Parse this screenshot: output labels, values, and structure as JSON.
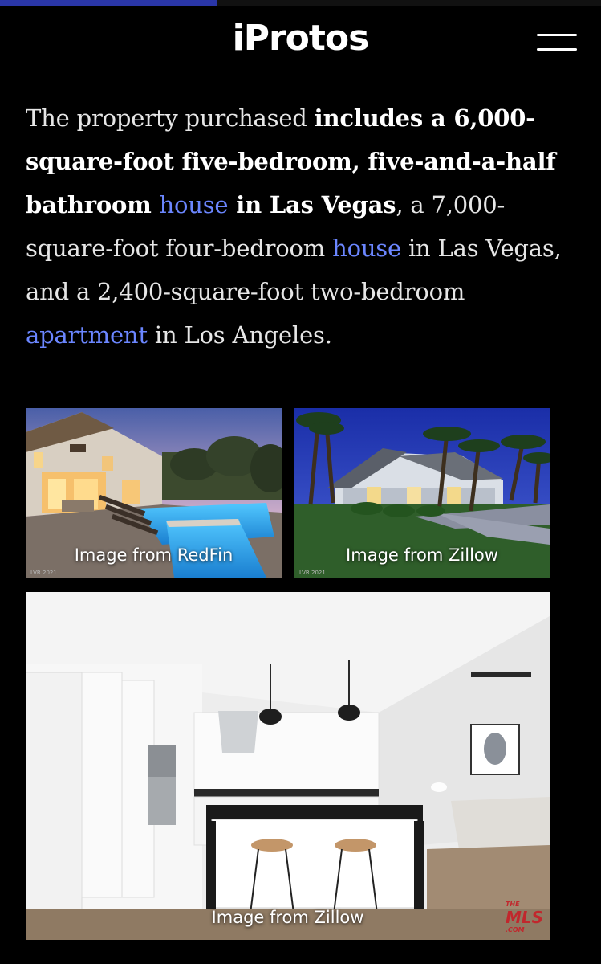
{
  "header": {
    "logo": "iProtos",
    "progress": 0.36
  },
  "article": {
    "p1": "The property purchased ",
    "b1": "includes a 6,000-square-foot five-bedroom, five-and-a-half bathroom ",
    "link1": "house",
    "b2": " in Las Vegas",
    "p2": ", a 7,000-square-foot four-bedroom ",
    "link2": "house",
    "p3": " in Las Vegas, and a 2,400-square-foot two-bedroom ",
    "link3": "apartment",
    "p4": " in Los Angeles."
  },
  "images": {
    "img1": {
      "caption": "Image from RedFin",
      "watermark": "LVR 2021"
    },
    "img2": {
      "caption": "Image from Zillow",
      "watermark": "LVR 2021"
    },
    "img3": {
      "caption": "Image from Zillow",
      "badge_top": "THE",
      "badge": "MLS",
      "badge_sub": ".COM"
    }
  },
  "icons": {
    "menu": "hamburger-menu-icon"
  },
  "colors": {
    "background": "#000000",
    "link": "#6b86ff",
    "progress": "#2a36a8"
  }
}
